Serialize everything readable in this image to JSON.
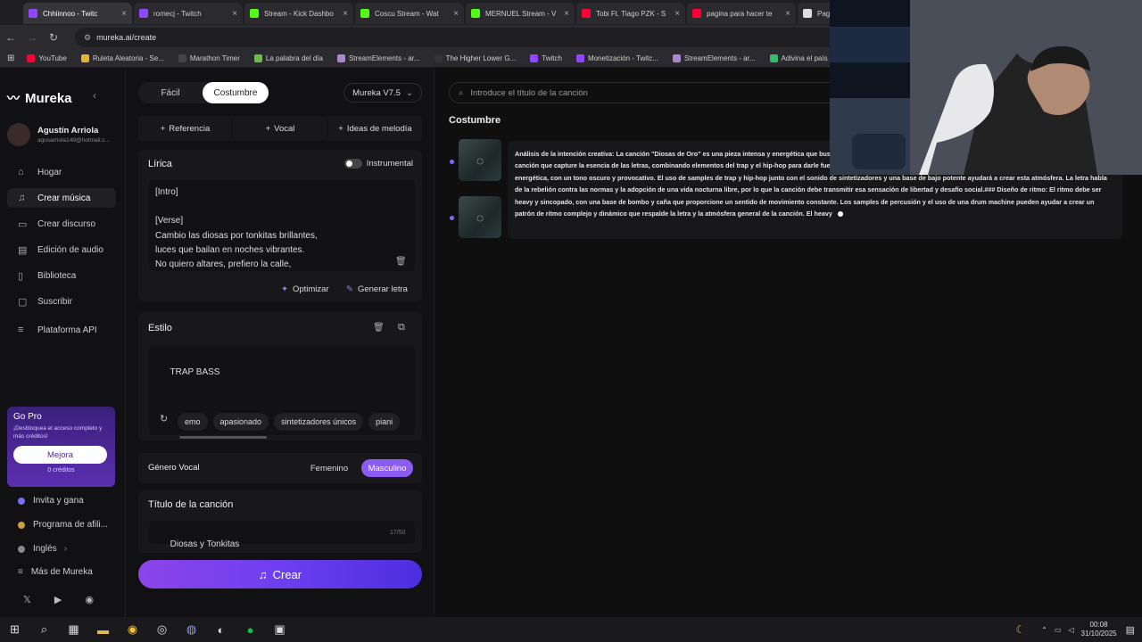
{
  "browser": {
    "tabs": [
      {
        "title": "Chhiinnoo - Twitc",
        "color": "#9146ff"
      },
      {
        "title": "romecj - Twitch",
        "color": "#9146ff"
      },
      {
        "title": "Stream - Kick Dashbo",
        "color": "#53fc18"
      },
      {
        "title": "Coscu Stream - Wat",
        "color": "#53fc18"
      },
      {
        "title": "MERNUEL Stream - V",
        "color": "#53fc18"
      },
      {
        "title": "Tobi Ft. Tiago PZK - S",
        "color": "#ff0033"
      },
      {
        "title": "pagina para hacer te",
        "color": "#ff0033"
      },
      {
        "title": "Pagin",
        "color": "#dddddd"
      }
    ],
    "url": "mureka.ai/create",
    "bookmarks": [
      {
        "label": "YouTube",
        "color": "#ff0033"
      },
      {
        "label": "Ruleta Aleatoria - Se...",
        "color": "#e8b030"
      },
      {
        "label": "Marathon Timer",
        "color": "#444444"
      },
      {
        "label": "La palabra del día",
        "color": "#6abf40"
      },
      {
        "label": "StreamElements - ar...",
        "color": "#aa88cc"
      },
      {
        "label": "The Higher Lower G...",
        "color": "#333333"
      },
      {
        "label": "Twitch",
        "color": "#9146ff"
      },
      {
        "label": "Monetización - Twitc...",
        "color": "#9146ff"
      },
      {
        "label": "StreamElements - ar...",
        "color": "#aa88cc"
      },
      {
        "label": "Adivina el país",
        "color": "#2dbf6a"
      },
      {
        "label": "Con",
        "color": "#ffffff"
      }
    ]
  },
  "sidebar": {
    "brand": "Mureka",
    "user_name": "Agustín Arriola",
    "user_email": "agusarriola149@hotmail.c...",
    "items": [
      {
        "label": "Hogar",
        "icon": "home-icon",
        "glyph": "⌂"
      },
      {
        "label": "Crear música",
        "icon": "music-note-icon",
        "glyph": "♫"
      },
      {
        "label": "Crear discurso",
        "icon": "speech-icon",
        "glyph": "▭"
      },
      {
        "label": "Edición de audio",
        "icon": "audio-edit-icon",
        "glyph": "▤"
      },
      {
        "label": "Biblioteca",
        "icon": "library-icon",
        "glyph": "▯"
      },
      {
        "label": "Suscribir",
        "icon": "subscribe-icon",
        "glyph": "▢"
      },
      {
        "label": "Plataforma API",
        "icon": "api-icon",
        "glyph": "≡"
      }
    ],
    "gopro_title": "Go Pro",
    "gopro_text": "¡Desbloquea el acceso completo y más créditos!",
    "gopro_button": "Mejora",
    "credits": "0 créditos",
    "links": [
      "Invita y gana",
      "Programa de afili...",
      "Inglés",
      "Más de Mureka"
    ]
  },
  "create": {
    "modes": [
      "Fácil",
      "Costumbre"
    ],
    "model": "Mureka V7.5",
    "quick": [
      "Referencia",
      "Vocal",
      "Ideas de melodía"
    ],
    "lyrics_title": "Lírica",
    "instrumental": "Instrumental",
    "lyrics": "[Intro]\n\n[Verse]\nCambio las diosas por tonkitas brillantes,\nluces que bailan en noches vibrantes.\nNo quiero altares, prefiero la calle,",
    "optimize": "Optimizar",
    "generate": "Generar letra",
    "style_title": "Estilo",
    "style_value": "TRAP BASS",
    "style_chips": [
      "emo",
      "apasionado",
      "sintetizadores únicos",
      "piani"
    ],
    "vocal_label": "Género Vocal",
    "female": "Femenino",
    "male": "Masculino",
    "song_title_label": "Título de la canción",
    "song_title": "Diosas y Tonkitas",
    "title_count": "17/50",
    "create_button": "Crear"
  },
  "results": {
    "search_placeholder": "Introduce el título de la canción",
    "section": "Costumbre",
    "analysis": "Análisis de la intención creativa: La canción \"Diosas de Oro\" es una pieza intensa y energética que busca reflejar la intensidad del texto y la ritmos sincopados y pesados. El objetivo es crear una canción que capture la esencia de las letras, combinando elementos del trap y el hip-hop para darle fuerza y ritmo al tema.### Determinar estilo y atmósfera: La atmósfera debe ser intensa y energética, con un tono oscuro y provocativo. El uso de samples de trap y hip-hop junto con el sonido de sintetizadores y una base de bajo potente ayudará a crear esta atmósfera. La letra habla de la rebelión contra las normas y la adopción de una vida nocturna libre, por lo que la canción debe transmitir esa sensación de libertad y desafío social.### Diseño de ritmo: El ritmo debe ser heavy y sincopado, con una base de bombo y caña que proporcione un sentido de movimiento constante. Los samples de percusión y el uso de una drum machine pueden ayudar a crear un patrón de ritmo complejo y dinámico que respalde la letra y la atmósfera general de la canción. El heavy"
  },
  "taskbar": {
    "time": "00:08",
    "date": "31/10/2025"
  }
}
